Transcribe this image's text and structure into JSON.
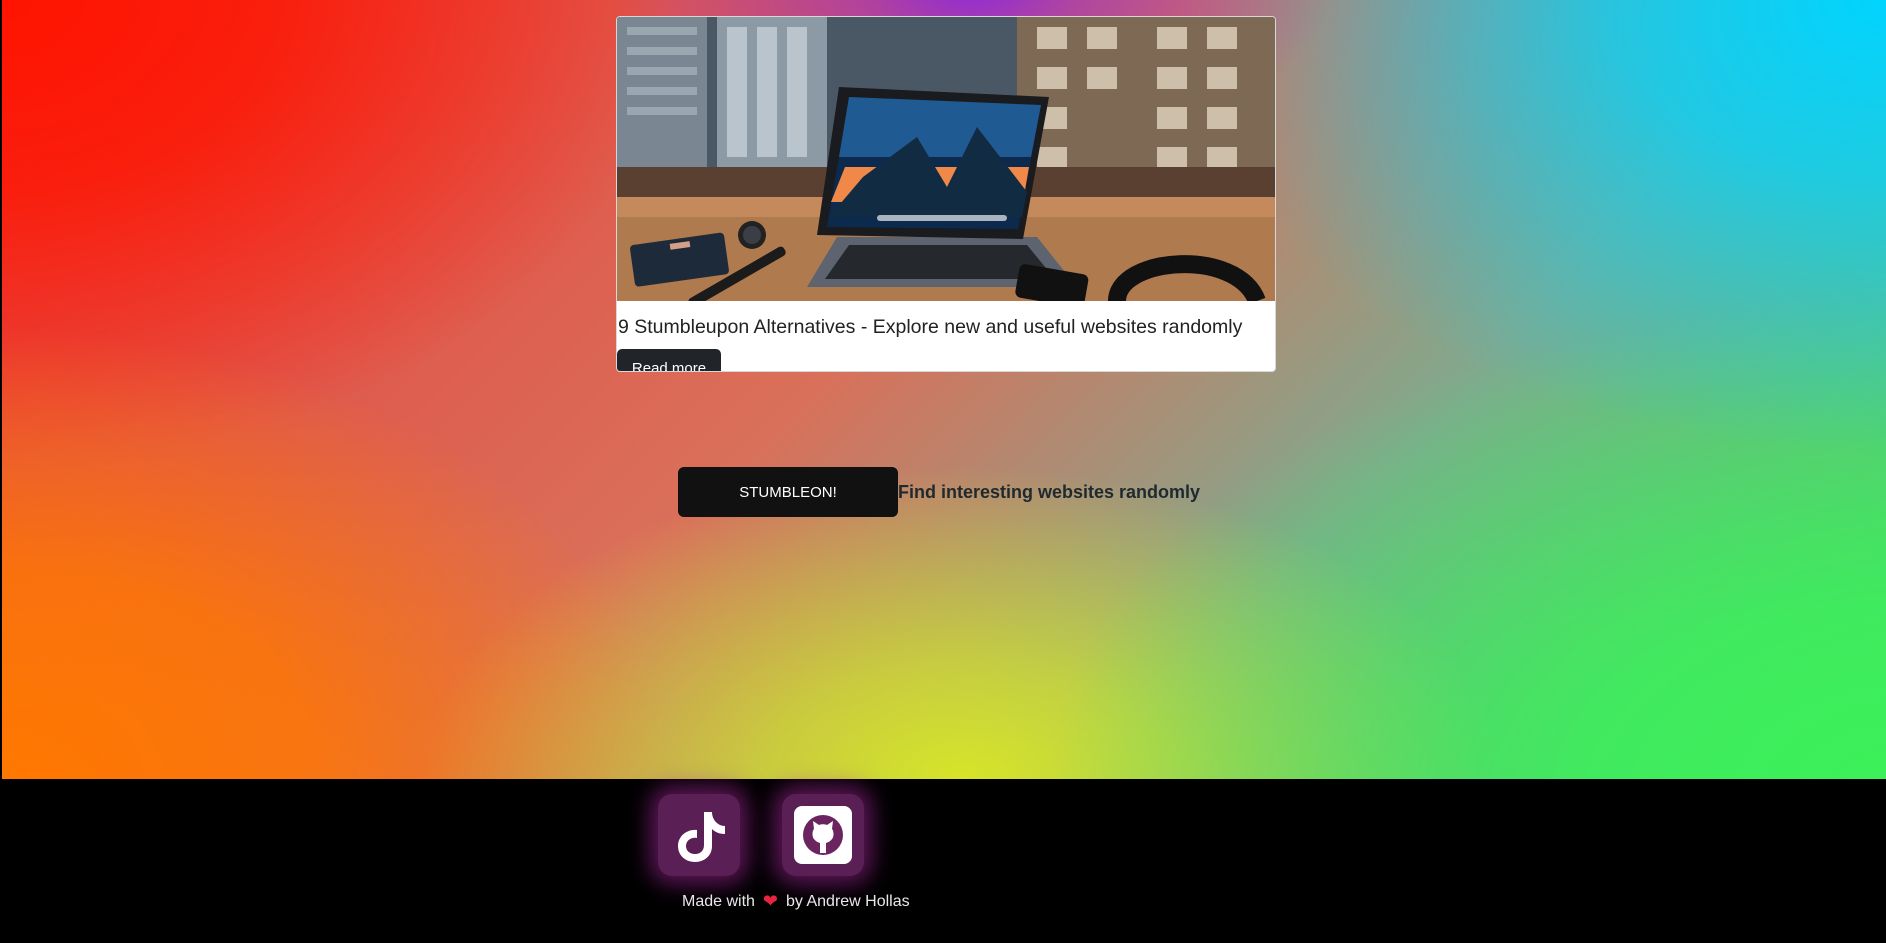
{
  "card": {
    "image_alt": "Laptop on a wooden desk by a window overlooking city buildings",
    "title": "9 Stumbleupon Alternatives - Explore new and useful websites randomly",
    "read_more_label": "Read more"
  },
  "stumble": {
    "button_label": "STUMBLEON!",
    "tagline": "Find interesting websites randomly"
  },
  "footer": {
    "made_with_prefix": "Made with",
    "heart_symbol": "❤",
    "made_with_suffix": "by Andrew Hollas",
    "social": [
      {
        "icon": "tiktok-icon"
      },
      {
        "icon": "github-icon"
      }
    ]
  },
  "colors": {
    "footer_bg": "#000000",
    "button_bg": "#111111",
    "heart": "#e8253e",
    "social_glow": "#aa28a0"
  }
}
